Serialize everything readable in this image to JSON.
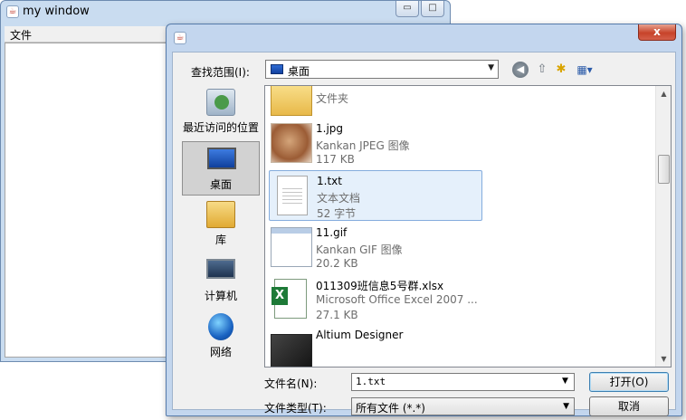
{
  "bg_window": {
    "title": "my window",
    "menu": [
      "文件"
    ],
    "controls": {
      "minimize": "▭",
      "maximize": "□"
    }
  },
  "dialog": {
    "close_glyph": "x",
    "look_in": {
      "label": "查找范围(I):",
      "value": "桌面"
    },
    "toolbar": {
      "back": "◀",
      "up": "⇧",
      "new_folder": "✱",
      "view": "▦▾"
    },
    "places": [
      {
        "label": "最近访问的位置",
        "icon": "recent-places-icon"
      },
      {
        "label": "桌面",
        "icon": "desktop-icon",
        "selected": true
      },
      {
        "label": "库",
        "icon": "library-icon"
      },
      {
        "label": "计算机",
        "icon": "computer-icon"
      },
      {
        "label": "网络",
        "icon": "network-icon"
      }
    ],
    "files": [
      {
        "name": "...",
        "type": "文件夹",
        "size": ""
      },
      {
        "name": "1.jpg",
        "type": "Kankan JPEG 图像",
        "size": "117 KB"
      },
      {
        "name": "1.txt",
        "type": "文本文档",
        "size": "52 字节",
        "selected": true
      },
      {
        "name": "11.gif",
        "type": "Kankan GIF 图像",
        "size": "20.2 KB"
      },
      {
        "name": "011309班信息5号群.xlsx",
        "type": "Microsoft Office Excel 2007 ...",
        "size": "27.1 KB"
      },
      {
        "name": "Altium Designer",
        "type": "",
        "size": ""
      }
    ],
    "file_name": {
      "label": "文件名(N):",
      "value": "1.txt"
    },
    "file_type": {
      "label": "文件类型(T):",
      "value": "所有文件 (*.*)"
    },
    "buttons": {
      "open": "打开(O)",
      "cancel": "取消"
    },
    "arrows": {
      "dropdown": "▼",
      "scroll_up": "▲",
      "scroll_down": "▼"
    },
    "colors": {
      "selection": "#e5f0fb",
      "selection_border": "#84acdd",
      "frame": "#c3d6ee"
    }
  }
}
